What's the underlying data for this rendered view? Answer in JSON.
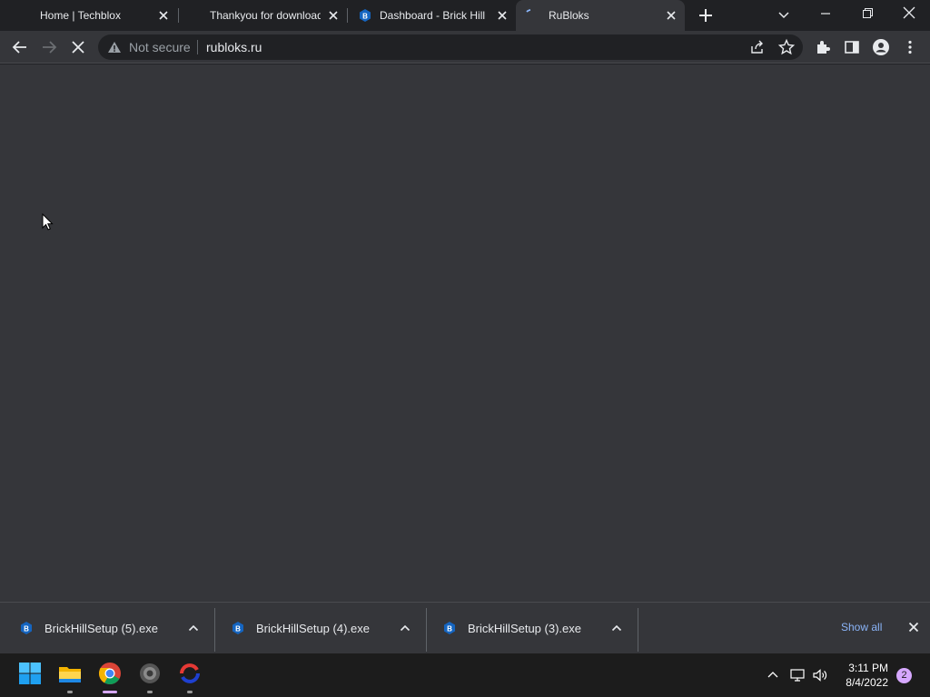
{
  "tabs": [
    {
      "title": "Home | Techblox",
      "favicon": "techblox-icon",
      "active": false
    },
    {
      "title": "Thankyou for downloading",
      "favicon": "blank-icon",
      "active": false
    },
    {
      "title": "Dashboard - Brick Hill",
      "favicon": "brickhill-icon",
      "active": false
    },
    {
      "title": "RuBloks",
      "favicon": "loading-icon",
      "active": true
    }
  ],
  "omnibox": {
    "security_label": "Not secure",
    "url": "rubloks.ru"
  },
  "downloads": [
    {
      "filename": "BrickHillSetup (5).exe",
      "icon": "brickhill-icon"
    },
    {
      "filename": "BrickHillSetup (4).exe",
      "icon": "brickhill-icon"
    },
    {
      "filename": "BrickHillSetup (3).exe",
      "icon": "brickhill-icon"
    }
  ],
  "shelf": {
    "show_all_label": "Show all"
  },
  "taskbar": {
    "apps": [
      "windows-start-icon",
      "file-explorer-icon",
      "chrome-icon",
      "app-icon",
      "brickhill-app-icon"
    ],
    "clock_time": "3:11 PM",
    "clock_date": "8/4/2022",
    "notification_count": "2"
  },
  "colors": {
    "frame": "#202124",
    "toolbar": "#35363a",
    "link": "#8ab4f8",
    "taskbar": "#1c1c1c"
  }
}
